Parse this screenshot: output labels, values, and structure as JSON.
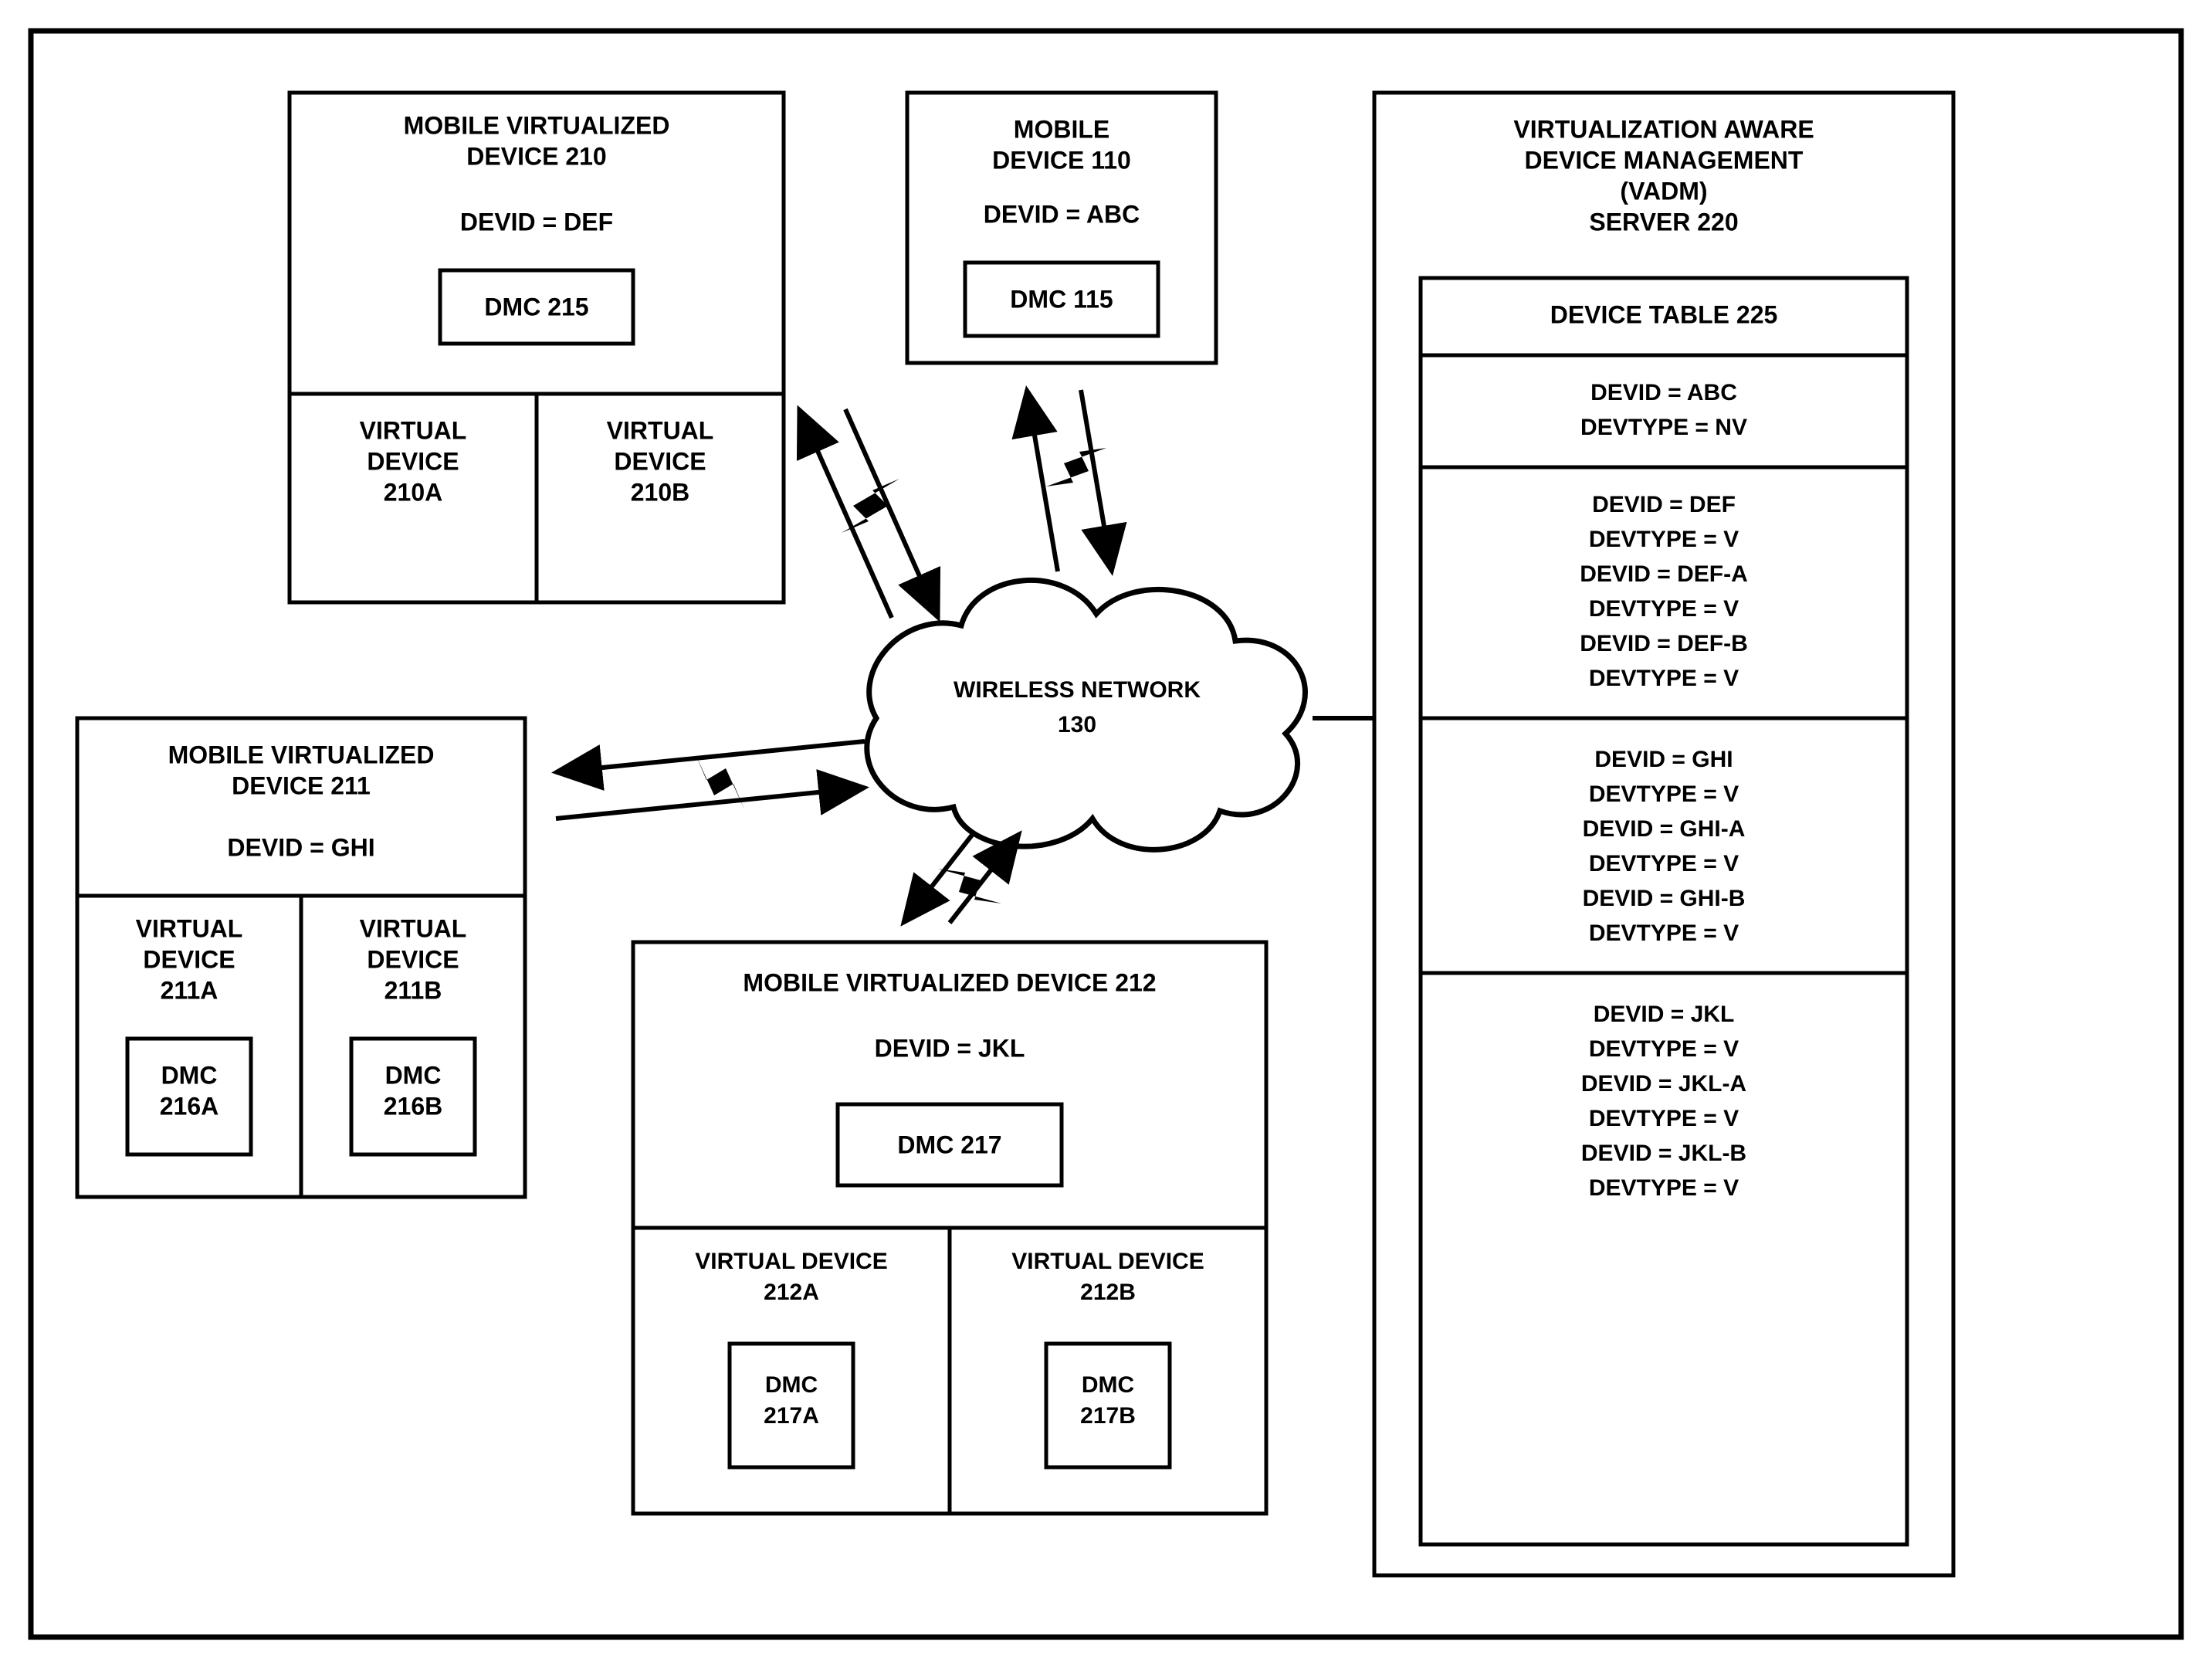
{
  "figure": {
    "mvd210": {
      "title1": "MOBILE VIRTUALIZED",
      "title2": "DEVICE 210",
      "devid": "DEVID = DEF",
      "dmc": "DMC 215",
      "vd_a_1": "VIRTUAL",
      "vd_a_2": "DEVICE",
      "vd_a_3": "210A",
      "vd_b_1": "VIRTUAL",
      "vd_b_2": "DEVICE",
      "vd_b_3": "210B"
    },
    "mvd211": {
      "title1": "MOBILE VIRTUALIZED",
      "title2": "DEVICE 211",
      "devid": "DEVID = GHI",
      "vd_a_1": "VIRTUAL",
      "vd_a_2": "DEVICE",
      "vd_a_3": "211A",
      "dmc_a_1": "DMC",
      "dmc_a_2": "216A",
      "vd_b_1": "VIRTUAL",
      "vd_b_2": "DEVICE",
      "vd_b_3": "211B",
      "dmc_b_1": "DMC",
      "dmc_b_2": "216B"
    },
    "mvd212": {
      "title": "MOBILE VIRTUALIZED DEVICE 212",
      "devid": "DEVID = JKL",
      "dmc": "DMC 217",
      "vd_a_1": "VIRTUAL DEVICE",
      "vd_a_2": "212A",
      "dmc_a_1": "DMC",
      "dmc_a_2": "217A",
      "vd_b_1": "VIRTUAL DEVICE",
      "vd_b_2": "212B",
      "dmc_b_1": "DMC",
      "dmc_b_2": "217B"
    },
    "md110": {
      "title1": "MOBILE",
      "title2": "DEVICE 110",
      "devid": "DEVID = ABC",
      "dmc": "DMC 115"
    },
    "network": {
      "label1": "WIRELESS NETWORK",
      "label2": "130"
    },
    "server": {
      "title1": "VIRTUALIZATION AWARE",
      "title2": "DEVICE MANAGEMENT",
      "title3": "(VADM)",
      "title4": "SERVER 220",
      "table_title": "DEVICE TABLE 225",
      "row1": [
        "DEVID = ABC",
        "DEVTYPE = NV"
      ],
      "row2": [
        "DEVID = DEF",
        "DEVTYPE = V",
        "DEVID = DEF-A",
        "DEVTYPE = V",
        "DEVID = DEF-B",
        "DEVTYPE = V"
      ],
      "row3": [
        "DEVID = GHI",
        "DEVTYPE = V",
        "DEVID = GHI-A",
        "DEVTYPE = V",
        "DEVID = GHI-B",
        "DEVTYPE = V"
      ],
      "row4": [
        "DEVID = JKL",
        "DEVTYPE = V",
        "DEVID = JKL-A",
        "DEVTYPE = V",
        "DEVID = JKL-B",
        "DEVTYPE = V"
      ]
    }
  }
}
